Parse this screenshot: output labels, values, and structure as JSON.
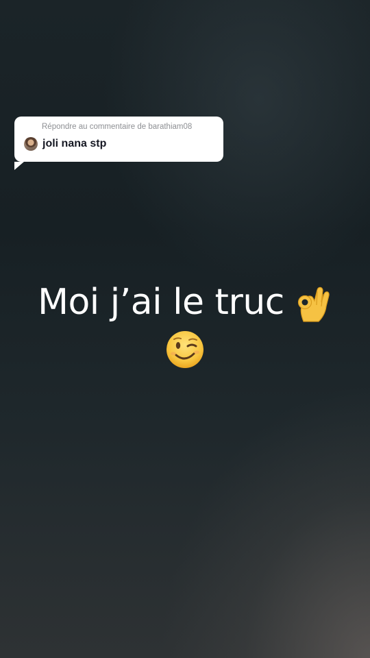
{
  "reply_bubble": {
    "reply_label": "Répondre au commentaire de barathiam08",
    "comment_text": "joli nana stp",
    "avatar": "avatar-photo"
  },
  "caption": {
    "line1_text": "Moi j’ai le truc",
    "line1_icon": "ok-hand-icon",
    "line2_icon": "winking-face-icon"
  },
  "colors": {
    "background_top": "#1b2428",
    "background_bottom_right": "#5a5552",
    "bubble_bg": "#ffffff",
    "reply_label": "#8d8f93",
    "comment_text": "#161823",
    "caption_text": "#ffffff"
  }
}
